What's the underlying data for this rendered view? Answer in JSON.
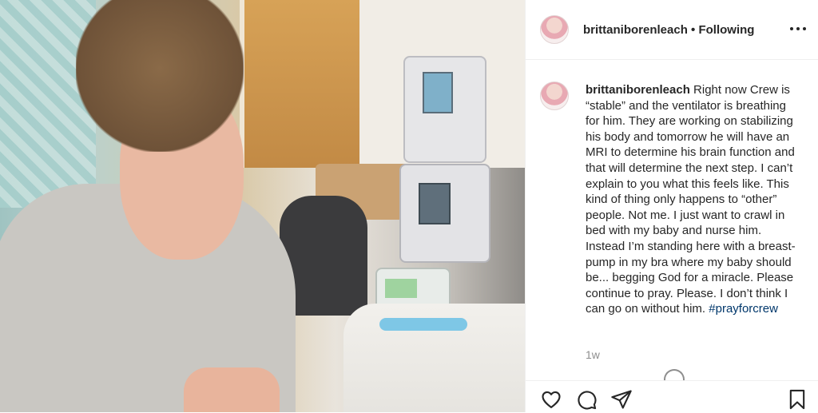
{
  "post": {
    "username": "brittaniborenleach",
    "separator": "•",
    "follow_status": "Following",
    "caption_author": "brittaniborenleach",
    "caption_body": "Right now Crew is “stable” and the ventilator is breathing for him. They are working on stabilizing his body and tomorrow he will have an MRI to determine his brain function and that will determine the next step. I can’t explain to you what this feels like. This kind of thing only happens to “other” people. Not me. I just want to crawl in bed with my baby and nurse him. Instead I’m standing here with a breast-pump in my bra where my baby should be... begging God for a miracle. Please continue to pray. Please. I don’t think I can go on without him.",
    "hashtag": "#prayforcrew",
    "timestamp": "1w"
  },
  "icons": {
    "more": "more-options-icon",
    "like": "heart-icon",
    "comment": "comment-icon",
    "share": "paper-plane-icon",
    "save": "bookmark-icon"
  },
  "colors": {
    "text": "#262626",
    "hashtag": "#00376b",
    "muted": "#8e8e8e",
    "divider": "#efefef"
  }
}
